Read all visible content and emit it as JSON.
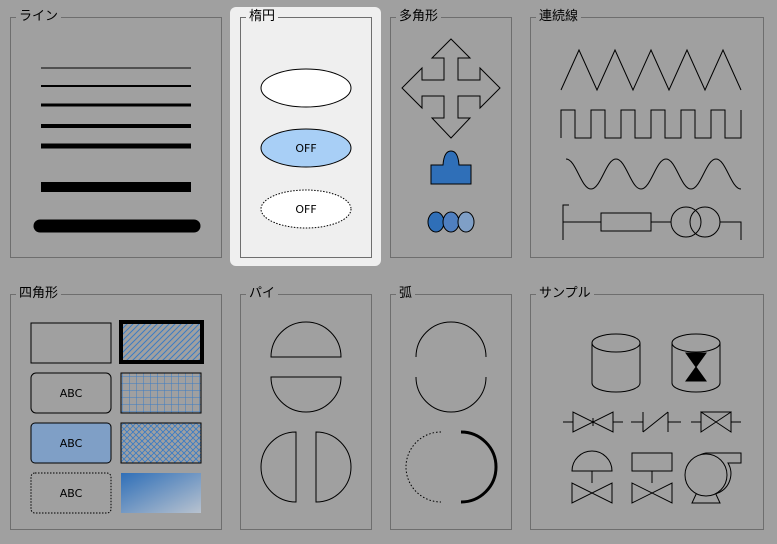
{
  "groups": {
    "line": {
      "title": "ライン"
    },
    "ellipse": {
      "title": "楕円",
      "selected": true,
      "labels": {
        "blue": "OFF",
        "dotted": "OFF"
      }
    },
    "polygon": {
      "title": "多角形"
    },
    "continuous_line": {
      "title": "連続線"
    },
    "rectangle": {
      "title": "四角形",
      "labels": {
        "rounded": "ABC",
        "filled": "ABC",
        "dotted": "ABC"
      }
    },
    "pie": {
      "title": "パイ"
    },
    "arc": {
      "title": "弧"
    },
    "sample": {
      "title": "サンプル"
    }
  },
  "colors": {
    "background": "#a0a0a0",
    "selected_panel": "#efefef",
    "light_blue": "#a8cff6",
    "steel_blue": "#7f9fc6",
    "shape_blue": "#2f6fb8",
    "hatch_blue": "#3a7cc5"
  }
}
